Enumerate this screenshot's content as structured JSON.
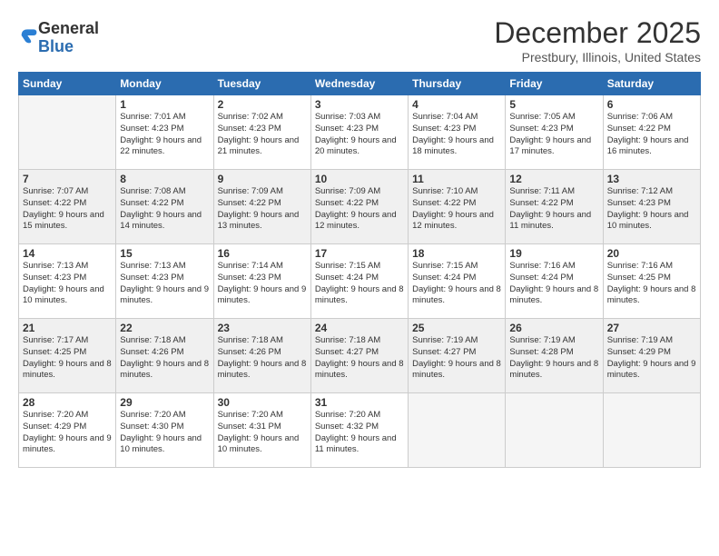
{
  "logo": {
    "general": "General",
    "blue": "Blue"
  },
  "title": "December 2025",
  "location": "Prestbury, Illinois, United States",
  "days_of_week": [
    "Sunday",
    "Monday",
    "Tuesday",
    "Wednesday",
    "Thursday",
    "Friday",
    "Saturday"
  ],
  "weeks": [
    [
      {
        "num": "",
        "sunrise": "",
        "sunset": "",
        "daylight": "",
        "empty": true
      },
      {
        "num": "1",
        "sunrise": "Sunrise: 7:01 AM",
        "sunset": "Sunset: 4:23 PM",
        "daylight": "Daylight: 9 hours and 22 minutes."
      },
      {
        "num": "2",
        "sunrise": "Sunrise: 7:02 AM",
        "sunset": "Sunset: 4:23 PM",
        "daylight": "Daylight: 9 hours and 21 minutes."
      },
      {
        "num": "3",
        "sunrise": "Sunrise: 7:03 AM",
        "sunset": "Sunset: 4:23 PM",
        "daylight": "Daylight: 9 hours and 20 minutes."
      },
      {
        "num": "4",
        "sunrise": "Sunrise: 7:04 AM",
        "sunset": "Sunset: 4:23 PM",
        "daylight": "Daylight: 9 hours and 18 minutes."
      },
      {
        "num": "5",
        "sunrise": "Sunrise: 7:05 AM",
        "sunset": "Sunset: 4:23 PM",
        "daylight": "Daylight: 9 hours and 17 minutes."
      },
      {
        "num": "6",
        "sunrise": "Sunrise: 7:06 AM",
        "sunset": "Sunset: 4:22 PM",
        "daylight": "Daylight: 9 hours and 16 minutes."
      }
    ],
    [
      {
        "num": "7",
        "sunrise": "Sunrise: 7:07 AM",
        "sunset": "Sunset: 4:22 PM",
        "daylight": "Daylight: 9 hours and 15 minutes."
      },
      {
        "num": "8",
        "sunrise": "Sunrise: 7:08 AM",
        "sunset": "Sunset: 4:22 PM",
        "daylight": "Daylight: 9 hours and 14 minutes."
      },
      {
        "num": "9",
        "sunrise": "Sunrise: 7:09 AM",
        "sunset": "Sunset: 4:22 PM",
        "daylight": "Daylight: 9 hours and 13 minutes."
      },
      {
        "num": "10",
        "sunrise": "Sunrise: 7:09 AM",
        "sunset": "Sunset: 4:22 PM",
        "daylight": "Daylight: 9 hours and 12 minutes."
      },
      {
        "num": "11",
        "sunrise": "Sunrise: 7:10 AM",
        "sunset": "Sunset: 4:22 PM",
        "daylight": "Daylight: 9 hours and 12 minutes."
      },
      {
        "num": "12",
        "sunrise": "Sunrise: 7:11 AM",
        "sunset": "Sunset: 4:22 PM",
        "daylight": "Daylight: 9 hours and 11 minutes."
      },
      {
        "num": "13",
        "sunrise": "Sunrise: 7:12 AM",
        "sunset": "Sunset: 4:23 PM",
        "daylight": "Daylight: 9 hours and 10 minutes."
      }
    ],
    [
      {
        "num": "14",
        "sunrise": "Sunrise: 7:13 AM",
        "sunset": "Sunset: 4:23 PM",
        "daylight": "Daylight: 9 hours and 10 minutes."
      },
      {
        "num": "15",
        "sunrise": "Sunrise: 7:13 AM",
        "sunset": "Sunset: 4:23 PM",
        "daylight": "Daylight: 9 hours and 9 minutes."
      },
      {
        "num": "16",
        "sunrise": "Sunrise: 7:14 AM",
        "sunset": "Sunset: 4:23 PM",
        "daylight": "Daylight: 9 hours and 9 minutes."
      },
      {
        "num": "17",
        "sunrise": "Sunrise: 7:15 AM",
        "sunset": "Sunset: 4:24 PM",
        "daylight": "Daylight: 9 hours and 8 minutes."
      },
      {
        "num": "18",
        "sunrise": "Sunrise: 7:15 AM",
        "sunset": "Sunset: 4:24 PM",
        "daylight": "Daylight: 9 hours and 8 minutes."
      },
      {
        "num": "19",
        "sunrise": "Sunrise: 7:16 AM",
        "sunset": "Sunset: 4:24 PM",
        "daylight": "Daylight: 9 hours and 8 minutes."
      },
      {
        "num": "20",
        "sunrise": "Sunrise: 7:16 AM",
        "sunset": "Sunset: 4:25 PM",
        "daylight": "Daylight: 9 hours and 8 minutes."
      }
    ],
    [
      {
        "num": "21",
        "sunrise": "Sunrise: 7:17 AM",
        "sunset": "Sunset: 4:25 PM",
        "daylight": "Daylight: 9 hours and 8 minutes."
      },
      {
        "num": "22",
        "sunrise": "Sunrise: 7:18 AM",
        "sunset": "Sunset: 4:26 PM",
        "daylight": "Daylight: 9 hours and 8 minutes."
      },
      {
        "num": "23",
        "sunrise": "Sunrise: 7:18 AM",
        "sunset": "Sunset: 4:26 PM",
        "daylight": "Daylight: 9 hours and 8 minutes."
      },
      {
        "num": "24",
        "sunrise": "Sunrise: 7:18 AM",
        "sunset": "Sunset: 4:27 PM",
        "daylight": "Daylight: 9 hours and 8 minutes."
      },
      {
        "num": "25",
        "sunrise": "Sunrise: 7:19 AM",
        "sunset": "Sunset: 4:27 PM",
        "daylight": "Daylight: 9 hours and 8 minutes."
      },
      {
        "num": "26",
        "sunrise": "Sunrise: 7:19 AM",
        "sunset": "Sunset: 4:28 PM",
        "daylight": "Daylight: 9 hours and 8 minutes."
      },
      {
        "num": "27",
        "sunrise": "Sunrise: 7:19 AM",
        "sunset": "Sunset: 4:29 PM",
        "daylight": "Daylight: 9 hours and 9 minutes."
      }
    ],
    [
      {
        "num": "28",
        "sunrise": "Sunrise: 7:20 AM",
        "sunset": "Sunset: 4:29 PM",
        "daylight": "Daylight: 9 hours and 9 minutes."
      },
      {
        "num": "29",
        "sunrise": "Sunrise: 7:20 AM",
        "sunset": "Sunset: 4:30 PM",
        "daylight": "Daylight: 9 hours and 10 minutes."
      },
      {
        "num": "30",
        "sunrise": "Sunrise: 7:20 AM",
        "sunset": "Sunset: 4:31 PM",
        "daylight": "Daylight: 9 hours and 10 minutes."
      },
      {
        "num": "31",
        "sunrise": "Sunrise: 7:20 AM",
        "sunset": "Sunset: 4:32 PM",
        "daylight": "Daylight: 9 hours and 11 minutes."
      },
      {
        "num": "",
        "sunrise": "",
        "sunset": "",
        "daylight": "",
        "empty": true
      },
      {
        "num": "",
        "sunrise": "",
        "sunset": "",
        "daylight": "",
        "empty": true
      },
      {
        "num": "",
        "sunrise": "",
        "sunset": "",
        "daylight": "",
        "empty": true
      }
    ]
  ]
}
